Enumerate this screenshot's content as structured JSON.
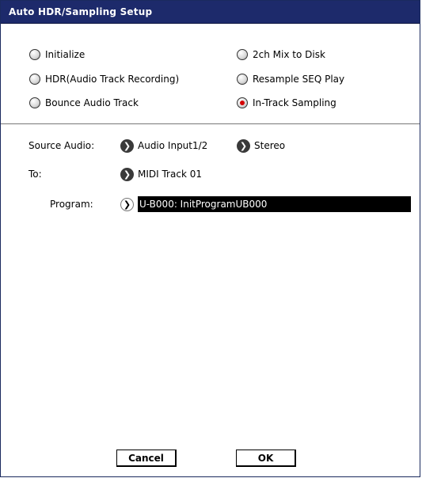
{
  "dialog": {
    "title": "Auto HDR/Sampling Setup"
  },
  "modes": [
    {
      "label": "Initialize",
      "selected": false
    },
    {
      "label": "2ch Mix to Disk",
      "selected": false
    },
    {
      "label": "HDR(Audio Track Recording)",
      "selected": false
    },
    {
      "label": "Resample SEQ Play",
      "selected": false
    },
    {
      "label": "Bounce Audio Track",
      "selected": false
    },
    {
      "label": "In-Track Sampling",
      "selected": true
    }
  ],
  "source_audio": {
    "label": "Source Audio:",
    "input_value": "Audio Input1/2",
    "mode_value": "Stereo"
  },
  "to": {
    "label": "To:",
    "value": "MIDI Track 01"
  },
  "program": {
    "label": "Program:",
    "value": "U-B000: InitProgramUB000"
  },
  "buttons": {
    "cancel": "Cancel",
    "ok": "OK"
  },
  "colors": {
    "titlebar": "#1d2a6b",
    "selected_radio": "#d30000",
    "program_field_bg": "#000000"
  }
}
